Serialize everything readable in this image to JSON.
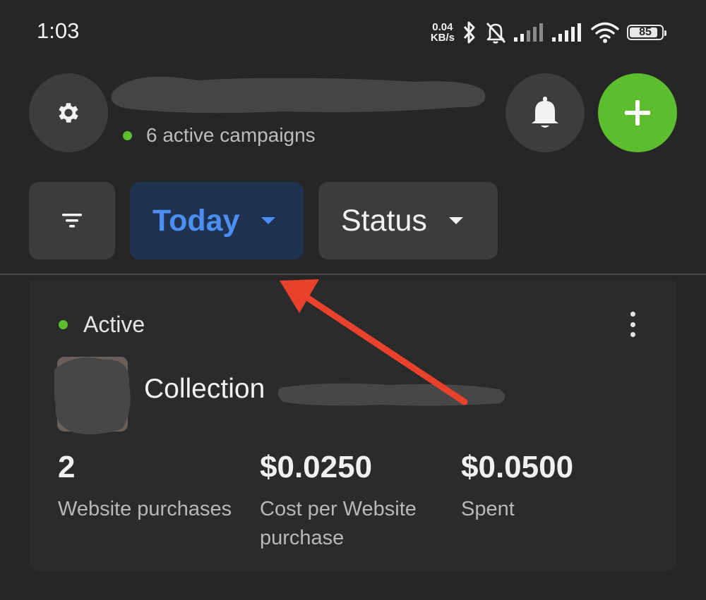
{
  "status_bar": {
    "time": "1:03",
    "net_speed_value": "0.04",
    "net_speed_unit": "KB/s",
    "battery": "85",
    "icons": [
      "bluetooth-icon",
      "bell-off-icon",
      "signal-icon",
      "signal-icon",
      "wifi-icon",
      "battery-icon"
    ]
  },
  "header": {
    "active_campaigns": "6 active campaigns",
    "icons": [
      "gear-icon",
      "bell-icon",
      "plus-icon"
    ],
    "accent": "#5cbd2f"
  },
  "filters": {
    "date_label": "Today",
    "status_label": "Status",
    "date_accent": "#4d8ef2"
  },
  "campaign": {
    "status": "Active",
    "name": "Collection",
    "metrics": [
      {
        "value": "2",
        "label": "Website purchases"
      },
      {
        "value": "$0.0250",
        "label": "Cost per Website purchase"
      },
      {
        "value": "$0.0500",
        "label": "Spent"
      }
    ]
  },
  "annotation": {
    "arrow_color": "#e8412c"
  }
}
